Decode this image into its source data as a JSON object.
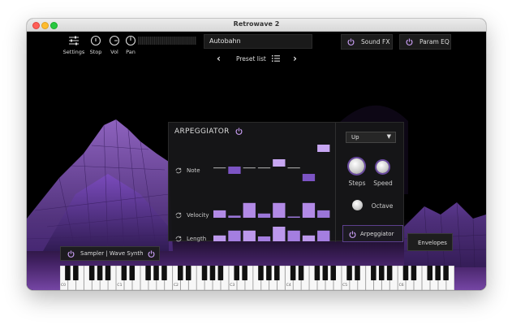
{
  "window": {
    "title": "Retrowave 2"
  },
  "toolbar": {
    "settings_label": "Settings",
    "stop_label": "Stop",
    "vol_label": "Vol",
    "pan_label": "Pan"
  },
  "preset": {
    "name": "Autobahn",
    "list_label": "Preset list"
  },
  "top_buttons": {
    "sound_fx": "Sound FX",
    "param_eq": "Param EQ"
  },
  "arpeggiator": {
    "title": "ARPEGGIATOR",
    "rows": {
      "note": "Note",
      "velocity": "Velocity",
      "length": "Length"
    },
    "direction": "Up",
    "knobs": {
      "steps": "Steps",
      "speed": "Speed",
      "octave": "Octave"
    },
    "tab_label": "Arpeggiator",
    "note_steps": [
      0,
      -1,
      0,
      0,
      1,
      0,
      -2,
      3
    ],
    "velocity_steps": [
      0.35,
      0.1,
      0.7,
      0.2,
      0.7,
      0.0,
      0.7,
      0.35
    ],
    "length_steps": [
      0.3,
      0.55,
      0.55,
      0.25,
      0.75,
      0.55,
      0.3,
      0.55
    ]
  },
  "bottom": {
    "sampler_label": "Sampler | Wave Synth",
    "envelopes_label": "Envelopes"
  },
  "keyboard": {
    "octave_labels": [
      "C0",
      "C1",
      "C2",
      "C3",
      "C4",
      "C5",
      "C6"
    ]
  },
  "colors": {
    "accent": "#b38be8",
    "accent_dark": "#7a4fc2",
    "panel": "#161618"
  }
}
